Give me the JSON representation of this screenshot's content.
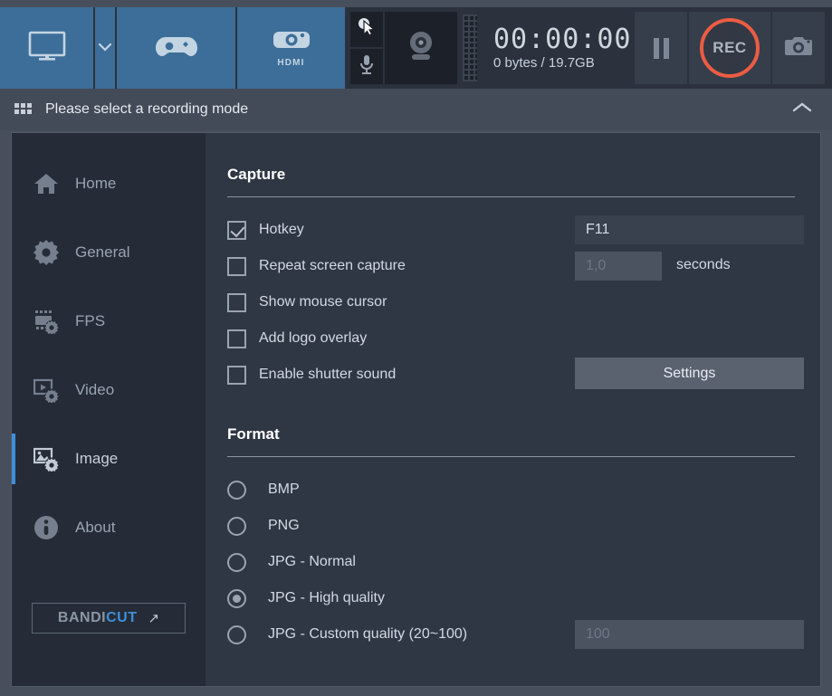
{
  "toolbar": {
    "modes": [
      {
        "name": "screen-recording-mode",
        "icon": "monitor-icon",
        "label": ""
      },
      {
        "name": "mode-dropdown",
        "icon": "chevron-down-icon",
        "label": ""
      },
      {
        "name": "game-recording-mode",
        "icon": "gamepad-icon",
        "label": ""
      },
      {
        "name": "device-recording-mode",
        "icon": "device-camera-icon",
        "label": "HDMI"
      }
    ],
    "cursor_toggle_icon": "mouse-cursor-icon",
    "mic_toggle_icon": "microphone-icon",
    "webcam_icon": "webcam-icon",
    "timer": "00:00:00",
    "storage": "0 bytes / 19.7GB",
    "pause_icon": "pause-icon",
    "record_label": "REC",
    "screenshot_icon": "camera-icon",
    "rec_ring_color": "#ec5c43"
  },
  "subheader": {
    "grid_icon": "grid-icon",
    "title": "Please select a recording mode",
    "collapse_icon": "chevron-up-icon"
  },
  "sidebar": {
    "items": [
      {
        "label": "Home",
        "icon": "home-icon",
        "active": false
      },
      {
        "label": "General",
        "icon": "gear-icon",
        "active": false
      },
      {
        "label": "FPS",
        "icon": "fps-gear-icon",
        "active": false
      },
      {
        "label": "Video",
        "icon": "video-gear-icon",
        "active": false
      },
      {
        "label": "Image",
        "icon": "image-gear-icon",
        "active": true
      },
      {
        "label": "About",
        "icon": "info-icon",
        "active": false
      }
    ],
    "bandicut": {
      "text_primary": "BANDI",
      "text_accent": "CUT",
      "accent_color": "#3f8fd8",
      "arrow_icon": "external-link-arrow-icon"
    }
  },
  "capture": {
    "title": "Capture",
    "options": [
      {
        "label": "Hotkey",
        "checked": true
      },
      {
        "label": "Repeat screen capture",
        "checked": false
      },
      {
        "label": "Show mouse cursor",
        "checked": false
      },
      {
        "label": "Add logo overlay",
        "checked": false
      },
      {
        "label": "Enable shutter sound",
        "checked": false
      }
    ],
    "hotkey_value": "F11",
    "repeat_placeholder": "1,0",
    "repeat_unit": "seconds",
    "settings_label": "Settings"
  },
  "format": {
    "title": "Format",
    "options": [
      {
        "label": "BMP",
        "selected": false
      },
      {
        "label": "PNG",
        "selected": false
      },
      {
        "label": "JPG - Normal",
        "selected": false
      },
      {
        "label": "JPG - High quality",
        "selected": true
      },
      {
        "label": "JPG - Custom quality (20~100)",
        "selected": false
      }
    ],
    "custom_quality_placeholder": "100"
  }
}
